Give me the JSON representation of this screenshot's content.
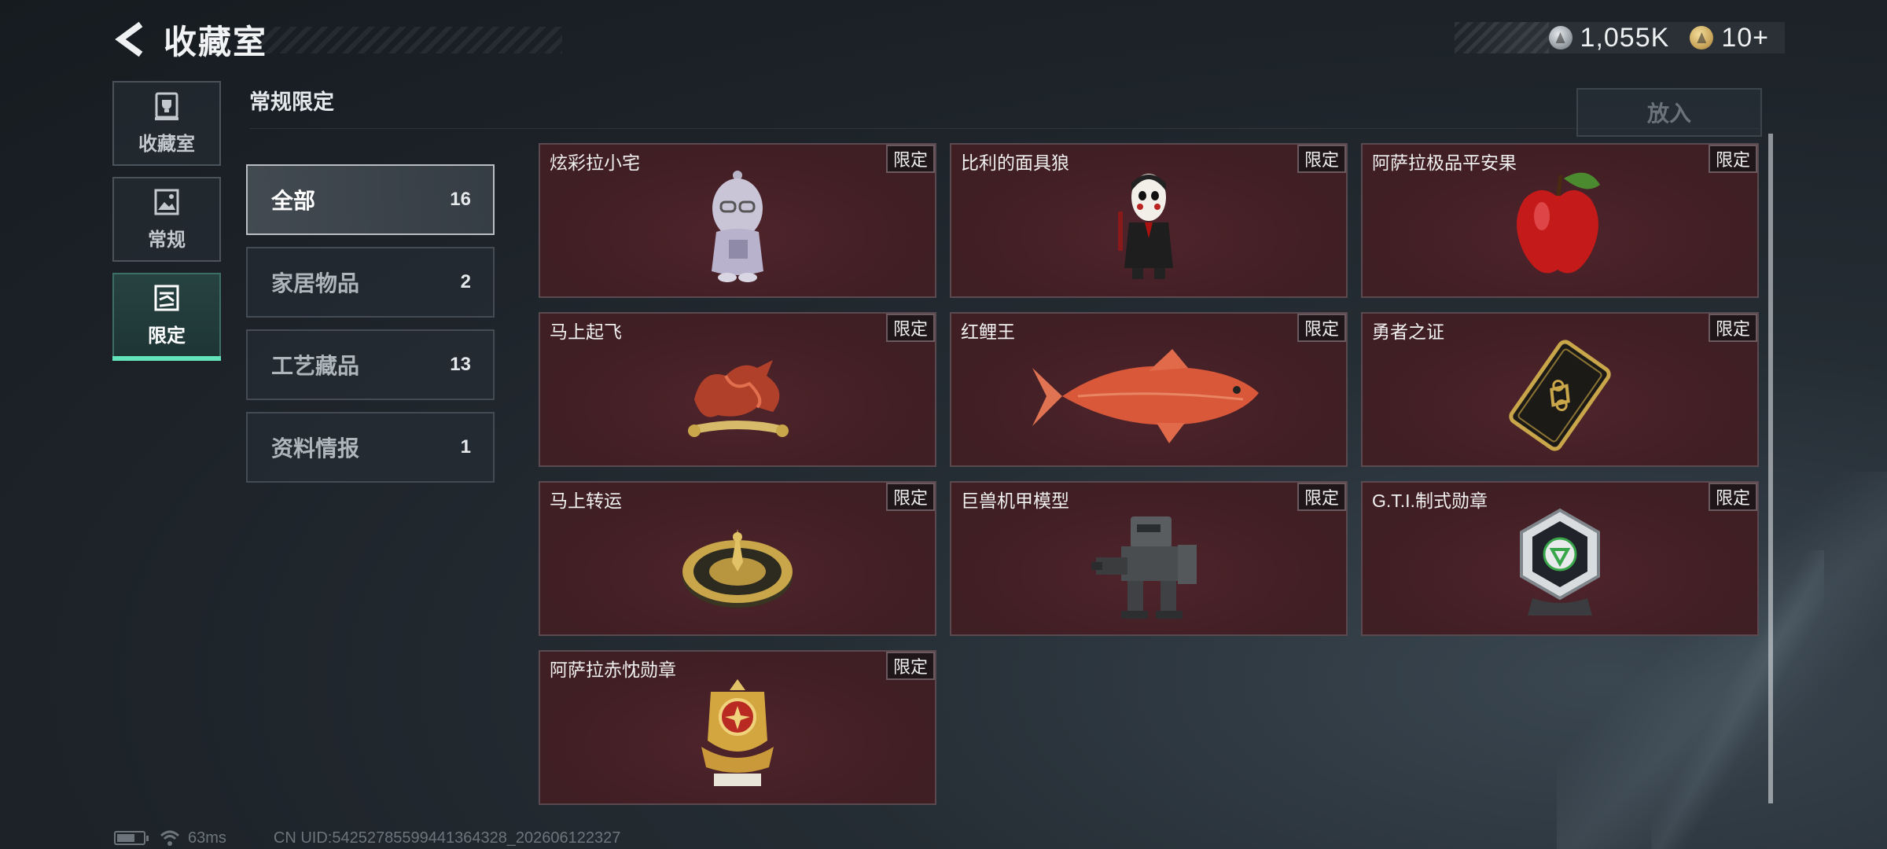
{
  "header": {
    "title": "收藏室",
    "back_icon": "chevron-left-icon"
  },
  "currency": [
    {
      "icon": "silver-coin-icon",
      "value": "1,055K"
    },
    {
      "icon": "gold-coin-icon",
      "value": "10+"
    }
  ],
  "side_nav": [
    {
      "label": "收藏室",
      "icon": "trophy-icon",
      "active": false
    },
    {
      "label": "常规",
      "icon": "picture-icon",
      "active": false
    },
    {
      "label": "限定",
      "icon": "limited-picture-icon",
      "active": true
    }
  ],
  "section_title": "常规限定",
  "categories": [
    {
      "name": "全部",
      "count": "16",
      "active": true
    },
    {
      "name": "家居物品",
      "count": "2",
      "active": false
    },
    {
      "name": "工艺藏品",
      "count": "13",
      "active": false
    },
    {
      "name": "资料情报",
      "count": "1",
      "active": false
    }
  ],
  "put_in_label": "放入",
  "items": [
    {
      "name": "炫彩拉小宅",
      "badge": "限定",
      "art": "doll"
    },
    {
      "name": "比利的面具狼",
      "badge": "限定",
      "art": "puppet"
    },
    {
      "name": "阿萨拉极品平安果",
      "badge": "限定",
      "art": "apple"
    },
    {
      "name": "马上起飞",
      "badge": "限定",
      "art": "horse"
    },
    {
      "name": "红鲤王",
      "badge": "限定",
      "art": "carp"
    },
    {
      "name": "勇者之证",
      "badge": "限定",
      "art": "card"
    },
    {
      "name": "马上转运",
      "badge": "限定",
      "art": "compass"
    },
    {
      "name": "巨兽机甲模型",
      "badge": "限定",
      "art": "mech"
    },
    {
      "name": "G.T.I.制式勋章",
      "badge": "限定",
      "art": "medal"
    },
    {
      "name": "阿萨拉赤忱勋章",
      "badge": "限定",
      "art": "gold-medal"
    }
  ],
  "footer": {
    "ping": "63ms",
    "uid": "CN UID:54252785599441364328_202606122327",
    "battery_level": 0.7
  },
  "colors": {
    "accent": "#62e3b9",
    "card_bg": "#3f1e24"
  }
}
